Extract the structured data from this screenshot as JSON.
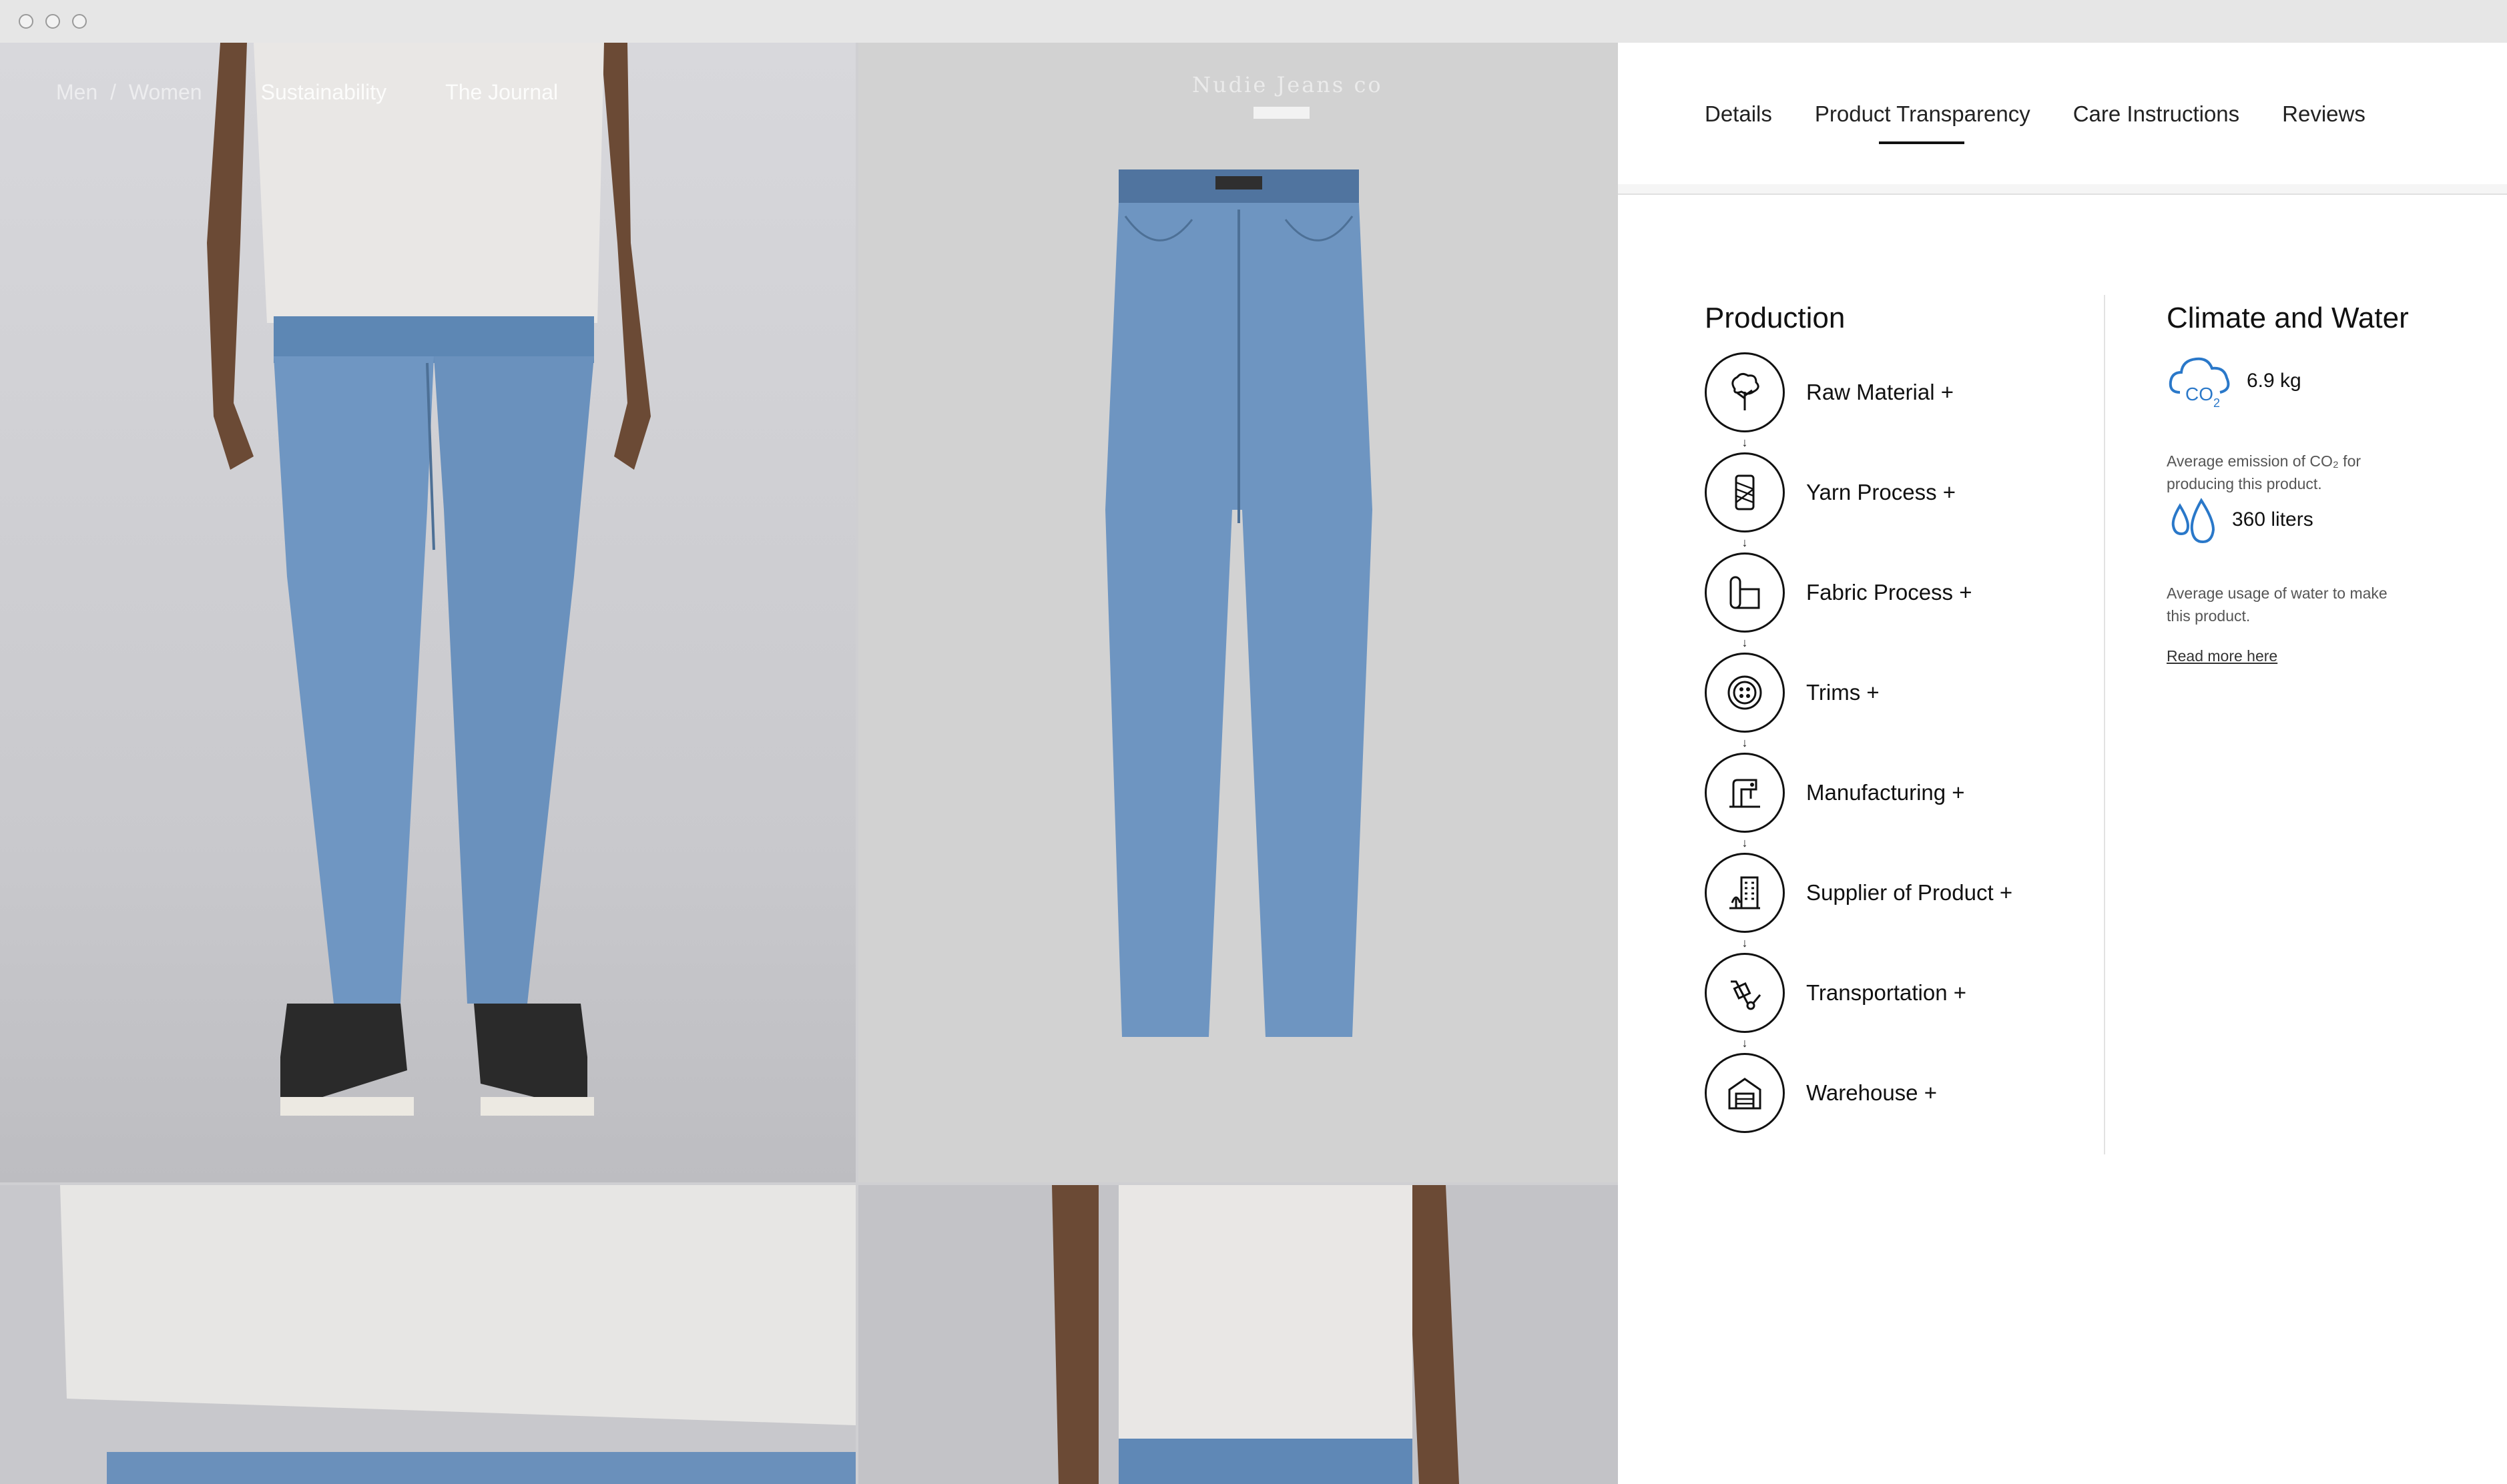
{
  "nav": {
    "men": "Men",
    "separator": "/",
    "women": "Women",
    "sustainability": "Sustainability",
    "journal": "The Journal"
  },
  "brand": {
    "logo": "Nudie Jeans co"
  },
  "tabs": [
    {
      "label": "Details"
    },
    {
      "label": "Product Transparency",
      "active": true
    },
    {
      "label": "Care Instructions"
    },
    {
      "label": "Reviews"
    }
  ],
  "production": {
    "title": "Production",
    "steps": [
      {
        "label": "Raw Material +",
        "icon": "cotton-plant-icon"
      },
      {
        "label": "Yarn Process +",
        "icon": "yarn-spool-icon"
      },
      {
        "label": "Fabric Process +",
        "icon": "fabric-roll-icon"
      },
      {
        "label": "Trims +",
        "icon": "button-icon"
      },
      {
        "label": "Manufacturing +",
        "icon": "sewing-machine-icon"
      },
      {
        "label": "Supplier of Product +",
        "icon": "factory-building-icon"
      },
      {
        "label": "Transportation +",
        "icon": "hand-truck-icon"
      },
      {
        "label": "Warehouse +",
        "icon": "warehouse-icon"
      }
    ]
  },
  "climate": {
    "title": "Climate and Water",
    "co2": {
      "value": "6.9 kg",
      "icon_text": "CO2",
      "desc": "Average emission of CO₂ for producing this product."
    },
    "water": {
      "value": "360 liters",
      "desc": "Average usage of water to make this product."
    },
    "read_more": "Read more here"
  },
  "colors": {
    "accent_blue": "#2a78c9",
    "text": "#111111"
  }
}
